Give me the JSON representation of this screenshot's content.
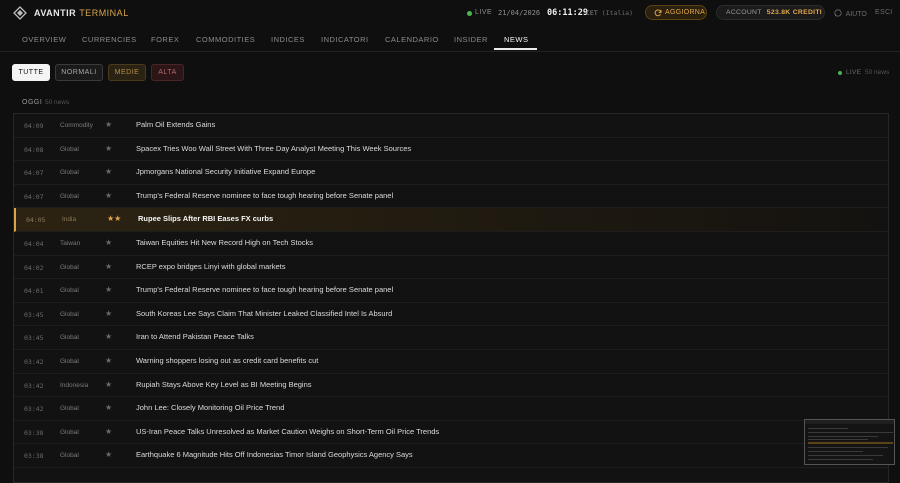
{
  "header": {
    "brand_main": "AVANTIR",
    "brand_accent": "TERMINAL",
    "live_label": "LIVE",
    "date": "21/04/2026",
    "time": "06:11:29",
    "tz": "CET",
    "tz_region": "(Italia)",
    "update_label": "AGGIORNA",
    "account_label": "ACCOUNT",
    "account_value": "523.8K CREDITI",
    "help_label": "AIUTO",
    "exit_label": "ESCI"
  },
  "nav": {
    "tabs": [
      "OVERVIEW",
      "CURRENCIES",
      "FOREX",
      "COMMODITIES",
      "INDICES",
      "INDICATORI",
      "CALENDARIO",
      "INSIDER",
      "NEWS"
    ],
    "active": "NEWS"
  },
  "filters": {
    "all": "TUTTE",
    "normal": "NORMALI",
    "medium": "MEDIE",
    "high": "ALTA",
    "live_label": "LIVE",
    "count_label": "50 news"
  },
  "section": {
    "title": "OGGI",
    "count": "50 news"
  },
  "news": [
    {
      "time": "04:09",
      "category": "Commodity",
      "stars": "★",
      "headline": "Palm Oil Extends Gains",
      "highlight": false
    },
    {
      "time": "04:08",
      "category": "Global",
      "stars": "★",
      "headline": "Spacex Tries Woo Wall Street With Three Day Analyst Meeting This Week Sources",
      "highlight": false
    },
    {
      "time": "04:07",
      "category": "Global",
      "stars": "★",
      "headline": "Jpmorgans National Security Initiative Expand Europe",
      "highlight": false
    },
    {
      "time": "04:07",
      "category": "Global",
      "stars": "★",
      "headline": "Trump's Federal Reserve nominee to face tough hearing before Senate panel",
      "highlight": false
    },
    {
      "time": "04:05",
      "category": "India",
      "stars": "★★",
      "headline": "Rupee Slips After RBI Eases FX curbs",
      "highlight": true
    },
    {
      "time": "04:04",
      "category": "Taiwan",
      "stars": "★",
      "headline": "Taiwan Equities Hit New Record High on Tech Stocks",
      "highlight": false
    },
    {
      "time": "04:02",
      "category": "Global",
      "stars": "★",
      "headline": "RCEP expo bridges Linyi with global markets",
      "highlight": false
    },
    {
      "time": "04:01",
      "category": "Global",
      "stars": "★",
      "headline": "Trump's Federal Reserve nominee to face tough hearing before Senate panel",
      "highlight": false
    },
    {
      "time": "03:45",
      "category": "Global",
      "stars": "★",
      "headline": "South Koreas Lee Says Claim That Minister Leaked Classified Intel Is Absurd",
      "highlight": false
    },
    {
      "time": "03:45",
      "category": "Global",
      "stars": "★",
      "headline": "Iran to Attend Pakistan Peace Talks",
      "highlight": false
    },
    {
      "time": "03:42",
      "category": "Global",
      "stars": "★",
      "headline": "Warning shoppers losing out as credit card benefits cut",
      "highlight": false
    },
    {
      "time": "03:42",
      "category": "Indonesia",
      "stars": "★",
      "headline": "Rupiah Stays Above Key Level as BI Meeting Begins",
      "highlight": false
    },
    {
      "time": "03:42",
      "category": "Global",
      "stars": "★",
      "headline": "John Lee: Closely Monitoring Oil Price Trend",
      "highlight": false
    },
    {
      "time": "03:38",
      "category": "Global",
      "stars": "★",
      "headline": "US-Iran Peace Talks Unresolved as Market Caution Weighs on Short-Term Oil Price Trends",
      "highlight": false
    },
    {
      "time": "03:38",
      "category": "Global",
      "stars": "★",
      "headline": "Earthquake 6 Magnitude Hits Off Indonesias Timor Island Geophysics Agency Says",
      "highlight": false
    }
  ]
}
